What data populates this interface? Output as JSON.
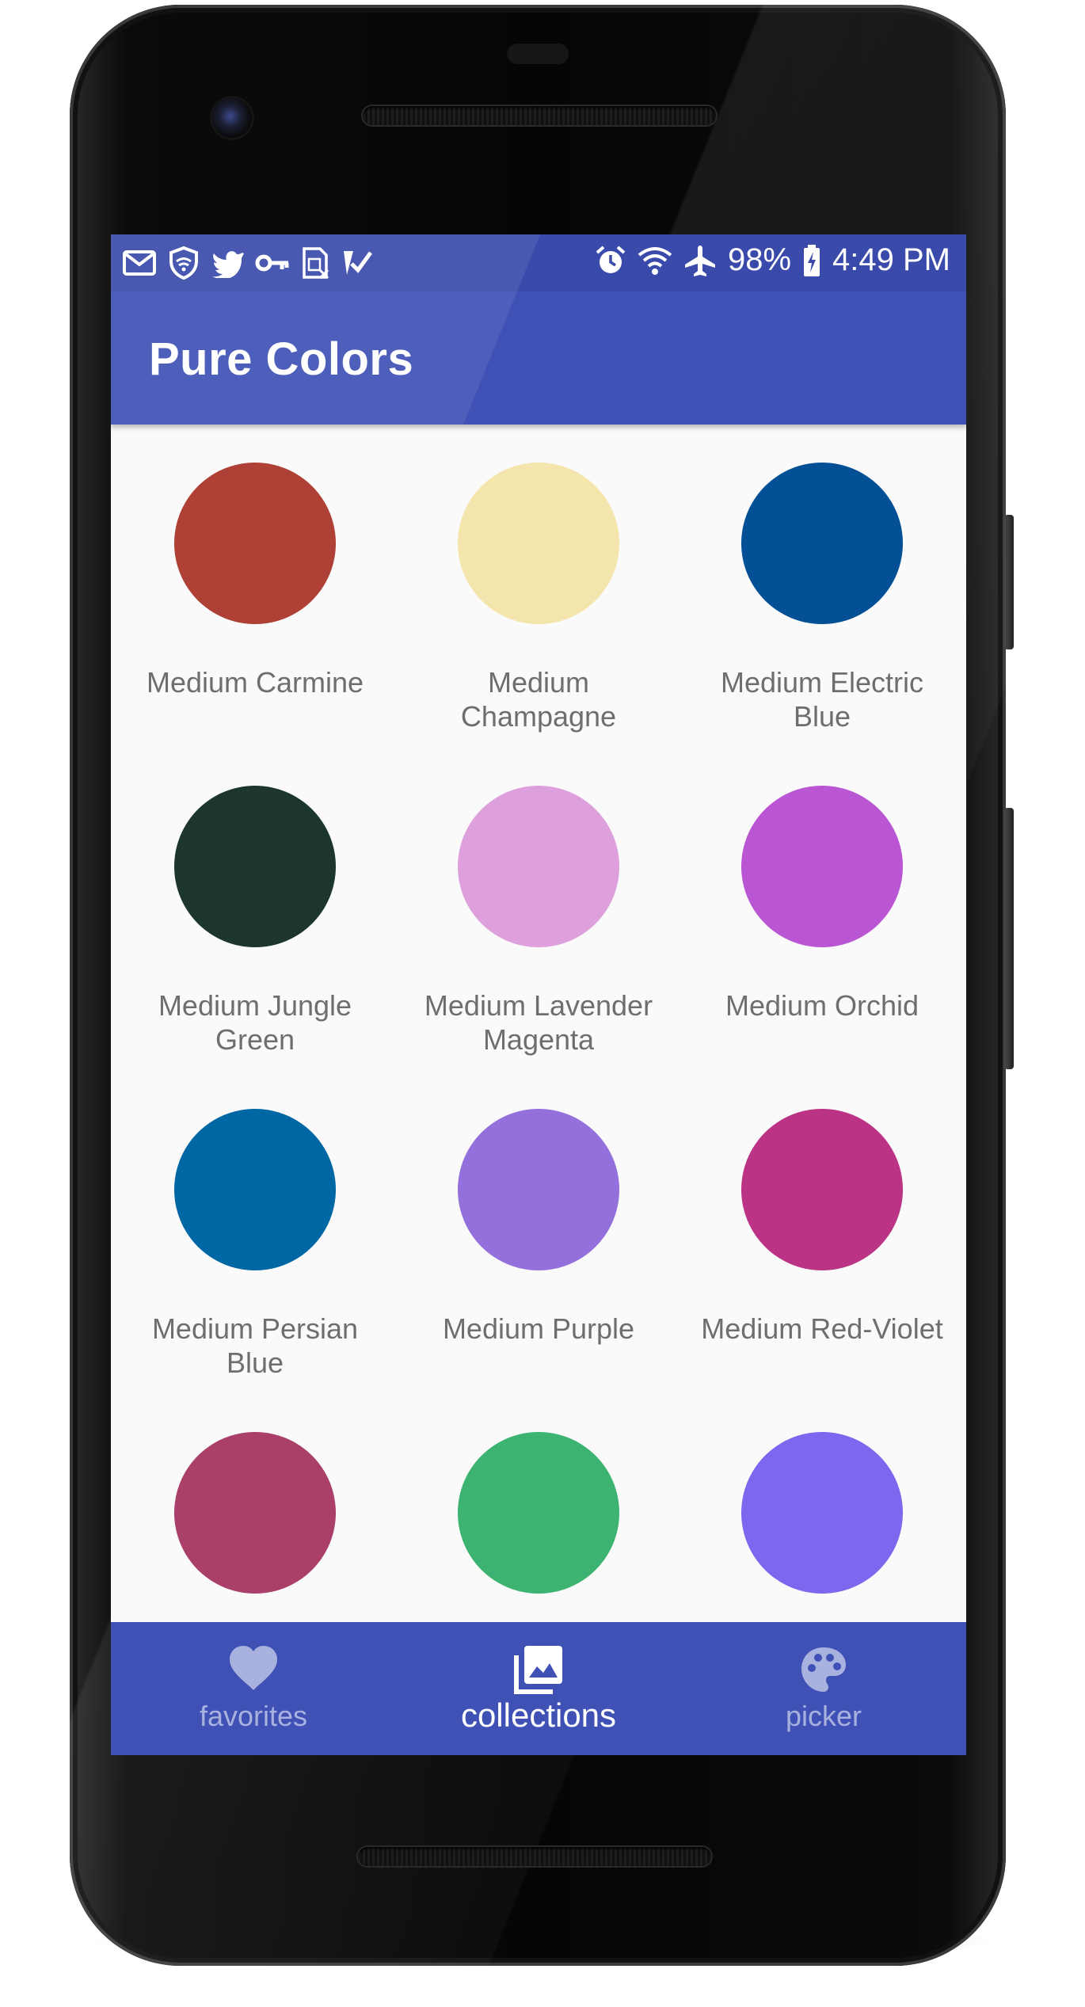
{
  "status_bar": {
    "left_icons": [
      "gmail-icon",
      "shield-wifi-icon",
      "twitter-icon",
      "key-icon",
      "sim-card-icon",
      "check-list-icon"
    ],
    "right_icons": [
      "alarm-icon",
      "wifi-icon",
      "airplane-icon"
    ],
    "battery": "98%",
    "time": "4:49 PM"
  },
  "app_bar": {
    "title": "Pure Colors",
    "color": "#3f51b5"
  },
  "colors": [
    {
      "name": "Medium Carmine",
      "hex": "#af4035"
    },
    {
      "name": "Medium Champagne",
      "hex": "#f3e5ab"
    },
    {
      "name": "Medium Electric Blue",
      "hex": "#035096"
    },
    {
      "name": "Medium Jungle Green",
      "hex": "#1c352d"
    },
    {
      "name": "Medium Lavender Magenta",
      "hex": "#dda0dd"
    },
    {
      "name": "Medium Orchid",
      "hex": "#ba55d3"
    },
    {
      "name": "Medium Persian Blue",
      "hex": "#0067a5"
    },
    {
      "name": "Medium Purple",
      "hex": "#9370db"
    },
    {
      "name": "Medium Red-Violet",
      "hex": "#bb3385"
    },
    {
      "name": "",
      "hex": "#aa4069"
    },
    {
      "name": "",
      "hex": "#3cb371"
    },
    {
      "name": "",
      "hex": "#7b68ee"
    }
  ],
  "bottom_nav": {
    "items": [
      {
        "label": "favorites",
        "icon": "heart-icon",
        "active": false
      },
      {
        "label": "collections",
        "icon": "photo-library-icon",
        "active": true
      },
      {
        "label": "picker",
        "icon": "palette-icon",
        "active": false
      }
    ]
  }
}
